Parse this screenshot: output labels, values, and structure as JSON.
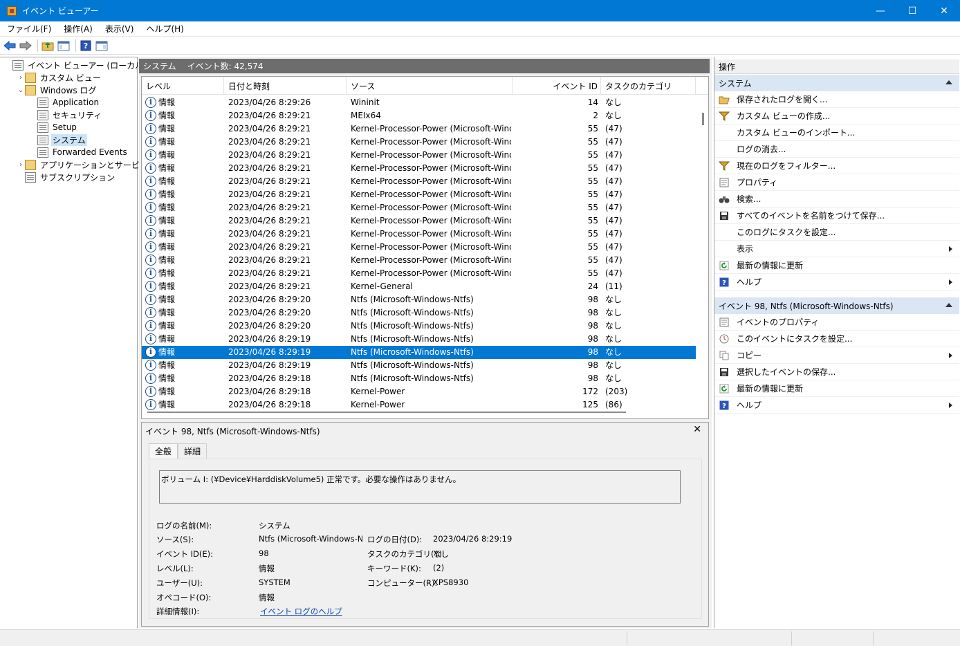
{
  "window": {
    "title": "イベント ビューアー"
  },
  "window_buttons": {
    "minimize": "—",
    "maximize": "☐",
    "close": "✕"
  },
  "menu": [
    "ファイル(F)",
    "操作(A)",
    "表示(V)",
    "ヘルプ(H)"
  ],
  "toolbar": {
    "back": "back-arrow-icon",
    "forward": "forward-arrow-icon",
    "up": "folder-up-icon",
    "show_hide_tree": "console-tree-icon",
    "help": "help-icon",
    "show_hide_action": "action-pane-icon"
  },
  "tree": [
    {
      "label": "イベント ビューアー (ローカル)",
      "indent": 0,
      "twisty": "",
      "icon": "event-viewer-icon"
    },
    {
      "label": "カスタム ビュー",
      "indent": 1,
      "twisty": "›",
      "icon": "folder-icon"
    },
    {
      "label": "Windows ログ",
      "indent": 1,
      "twisty": "⌄",
      "icon": "folder-icon"
    },
    {
      "label": "Application",
      "indent": 2,
      "twisty": "",
      "icon": "log-icon"
    },
    {
      "label": "セキュリティ",
      "indent": 2,
      "twisty": "",
      "icon": "log-icon"
    },
    {
      "label": "Setup",
      "indent": 2,
      "twisty": "",
      "icon": "log-icon"
    },
    {
      "label": "システム",
      "indent": 2,
      "twisty": "",
      "icon": "log-icon",
      "selected": true
    },
    {
      "label": "Forwarded Events",
      "indent": 2,
      "twisty": "",
      "icon": "log-icon"
    },
    {
      "label": "アプリケーションとサービス ログ",
      "indent": 1,
      "twisty": "›",
      "icon": "folder-icon"
    },
    {
      "label": "サブスクリプション",
      "indent": 1,
      "twisty": "",
      "icon": "subscription-icon"
    }
  ],
  "center": {
    "log_name": "システム",
    "event_count": "イベント数: 42,574",
    "columns": [
      "レベル",
      "日付と時刻",
      "ソース",
      "イベント ID",
      "タスクのカテゴリ"
    ],
    "rows": [
      [
        "情報",
        "2023/04/26 8:29:26",
        "Wininit",
        "14",
        "なし"
      ],
      [
        "情報",
        "2023/04/26 8:29:21",
        "MEIx64",
        "2",
        "なし"
      ],
      [
        "情報",
        "2023/04/26 8:29:21",
        "Kernel-Processor-Power (Microsoft-Wind...",
        "55",
        "(47)"
      ],
      [
        "情報",
        "2023/04/26 8:29:21",
        "Kernel-Processor-Power (Microsoft-Wind...",
        "55",
        "(47)"
      ],
      [
        "情報",
        "2023/04/26 8:29:21",
        "Kernel-Processor-Power (Microsoft-Wind...",
        "55",
        "(47)"
      ],
      [
        "情報",
        "2023/04/26 8:29:21",
        "Kernel-Processor-Power (Microsoft-Wind...",
        "55",
        "(47)"
      ],
      [
        "情報",
        "2023/04/26 8:29:21",
        "Kernel-Processor-Power (Microsoft-Wind...",
        "55",
        "(47)"
      ],
      [
        "情報",
        "2023/04/26 8:29:21",
        "Kernel-Processor-Power (Microsoft-Wind...",
        "55",
        "(47)"
      ],
      [
        "情報",
        "2023/04/26 8:29:21",
        "Kernel-Processor-Power (Microsoft-Wind...",
        "55",
        "(47)"
      ],
      [
        "情報",
        "2023/04/26 8:29:21",
        "Kernel-Processor-Power (Microsoft-Wind...",
        "55",
        "(47)"
      ],
      [
        "情報",
        "2023/04/26 8:29:21",
        "Kernel-Processor-Power (Microsoft-Wind...",
        "55",
        "(47)"
      ],
      [
        "情報",
        "2023/04/26 8:29:21",
        "Kernel-Processor-Power (Microsoft-Wind...",
        "55",
        "(47)"
      ],
      [
        "情報",
        "2023/04/26 8:29:21",
        "Kernel-Processor-Power (Microsoft-Wind...",
        "55",
        "(47)"
      ],
      [
        "情報",
        "2023/04/26 8:29:21",
        "Kernel-Processor-Power (Microsoft-Wind...",
        "55",
        "(47)"
      ],
      [
        "情報",
        "2023/04/26 8:29:21",
        "Kernel-General",
        "24",
        "(11)"
      ],
      [
        "情報",
        "2023/04/26 8:29:20",
        "Ntfs (Microsoft-Windows-Ntfs)",
        "98",
        "なし"
      ],
      [
        "情報",
        "2023/04/26 8:29:20",
        "Ntfs (Microsoft-Windows-Ntfs)",
        "98",
        "なし"
      ],
      [
        "情報",
        "2023/04/26 8:29:20",
        "Ntfs (Microsoft-Windows-Ntfs)",
        "98",
        "なし"
      ],
      [
        "情報",
        "2023/04/26 8:29:19",
        "Ntfs (Microsoft-Windows-Ntfs)",
        "98",
        "なし"
      ],
      [
        "情報",
        "2023/04/26 8:29:19",
        "Ntfs (Microsoft-Windows-Ntfs)",
        "98",
        "なし"
      ],
      [
        "情報",
        "2023/04/26 8:29:19",
        "Ntfs (Microsoft-Windows-Ntfs)",
        "98",
        "なし"
      ],
      [
        "情報",
        "2023/04/26 8:29:18",
        "Ntfs (Microsoft-Windows-Ntfs)",
        "98",
        "なし"
      ],
      [
        "情報",
        "2023/04/26 8:29:18",
        "Kernel-Power",
        "172",
        "(203)"
      ],
      [
        "情報",
        "2023/04/26 8:29:18",
        "Kernel-Power",
        "125",
        "(86)"
      ]
    ],
    "selected_row": 19
  },
  "detail": {
    "title": "イベント 98, Ntfs (Microsoft-Windows-Ntfs)",
    "close": "✕",
    "tabs": [
      "全般",
      "詳細"
    ],
    "message": "ボリューム I: (¥Device¥HarddiskVolume5) 正常です。必要な操作はありません。",
    "fields": {
      "log_name_label": "ログの名前(M):",
      "log_name": "システム",
      "source_label": "ソース(S):",
      "source": "Ntfs (Microsoft-Windows-Ntf",
      "logged_label": "ログの日付(D):",
      "logged": "2023/04/26 8:29:19",
      "event_id_label": "イベント ID(E):",
      "event_id": "98",
      "task_label": "タスクのカテゴリ(Y):",
      "task": "なし",
      "level_label": "レベル(L):",
      "level": "情報",
      "keywords_label": "キーワード(K):",
      "keywords": "(2)",
      "user_label": "ユーザー(U):",
      "user": "SYSTEM",
      "computer_label": "コンピューター(R):",
      "computer": "XPS8930",
      "opcode_label": "オペコード(O):",
      "opcode": "情報",
      "more_info_label": "詳細情報(I):",
      "more_info": "イベント ログのヘルプ"
    }
  },
  "actions": {
    "title": "操作",
    "group1": {
      "title": "システム",
      "items": [
        {
          "label": "保存されたログを開く...",
          "icon": "open-folder-icon",
          "sub": false
        },
        {
          "label": "カスタム ビューの作成...",
          "icon": "filter-icon",
          "sub": false
        },
        {
          "label": "カスタム ビューのインポート...",
          "icon": "",
          "sub": false
        },
        {
          "label": "ログの消去...",
          "icon": "",
          "sub": false
        },
        {
          "label": "現在のログをフィルター...",
          "icon": "filter-icon",
          "sub": false
        },
        {
          "label": "プロパティ",
          "icon": "properties-icon",
          "sub": false
        },
        {
          "label": "検索...",
          "icon": "binoculars-icon",
          "sub": false
        },
        {
          "label": "すべてのイベントを名前をつけて保存...",
          "icon": "save-icon",
          "sub": false
        },
        {
          "label": "このログにタスクを設定...",
          "icon": "",
          "sub": false
        },
        {
          "label": "表示",
          "icon": "",
          "sub": true
        },
        {
          "label": "最新の情報に更新",
          "icon": "refresh-icon",
          "sub": false
        },
        {
          "label": "ヘルプ",
          "icon": "help-icon",
          "sub": true
        }
      ]
    },
    "group2": {
      "title": "イベント 98, Ntfs (Microsoft-Windows-Ntfs)",
      "items": [
        {
          "label": "イベントのプロパティ",
          "icon": "properties-icon",
          "sub": false
        },
        {
          "label": "このイベントにタスクを設定...",
          "icon": "task-icon",
          "sub": false
        },
        {
          "label": "コピー",
          "icon": "copy-icon",
          "sub": true
        },
        {
          "label": "選択したイベントの保存...",
          "icon": "save-icon",
          "sub": false
        },
        {
          "label": "最新の情報に更新",
          "icon": "refresh-icon",
          "sub": false
        },
        {
          "label": "ヘルプ",
          "icon": "help-icon",
          "sub": true
        }
      ]
    }
  },
  "colors": {
    "accent": "#0078d4",
    "header_gray": "#6d6d6d",
    "group_bg": "#dae6f3"
  }
}
